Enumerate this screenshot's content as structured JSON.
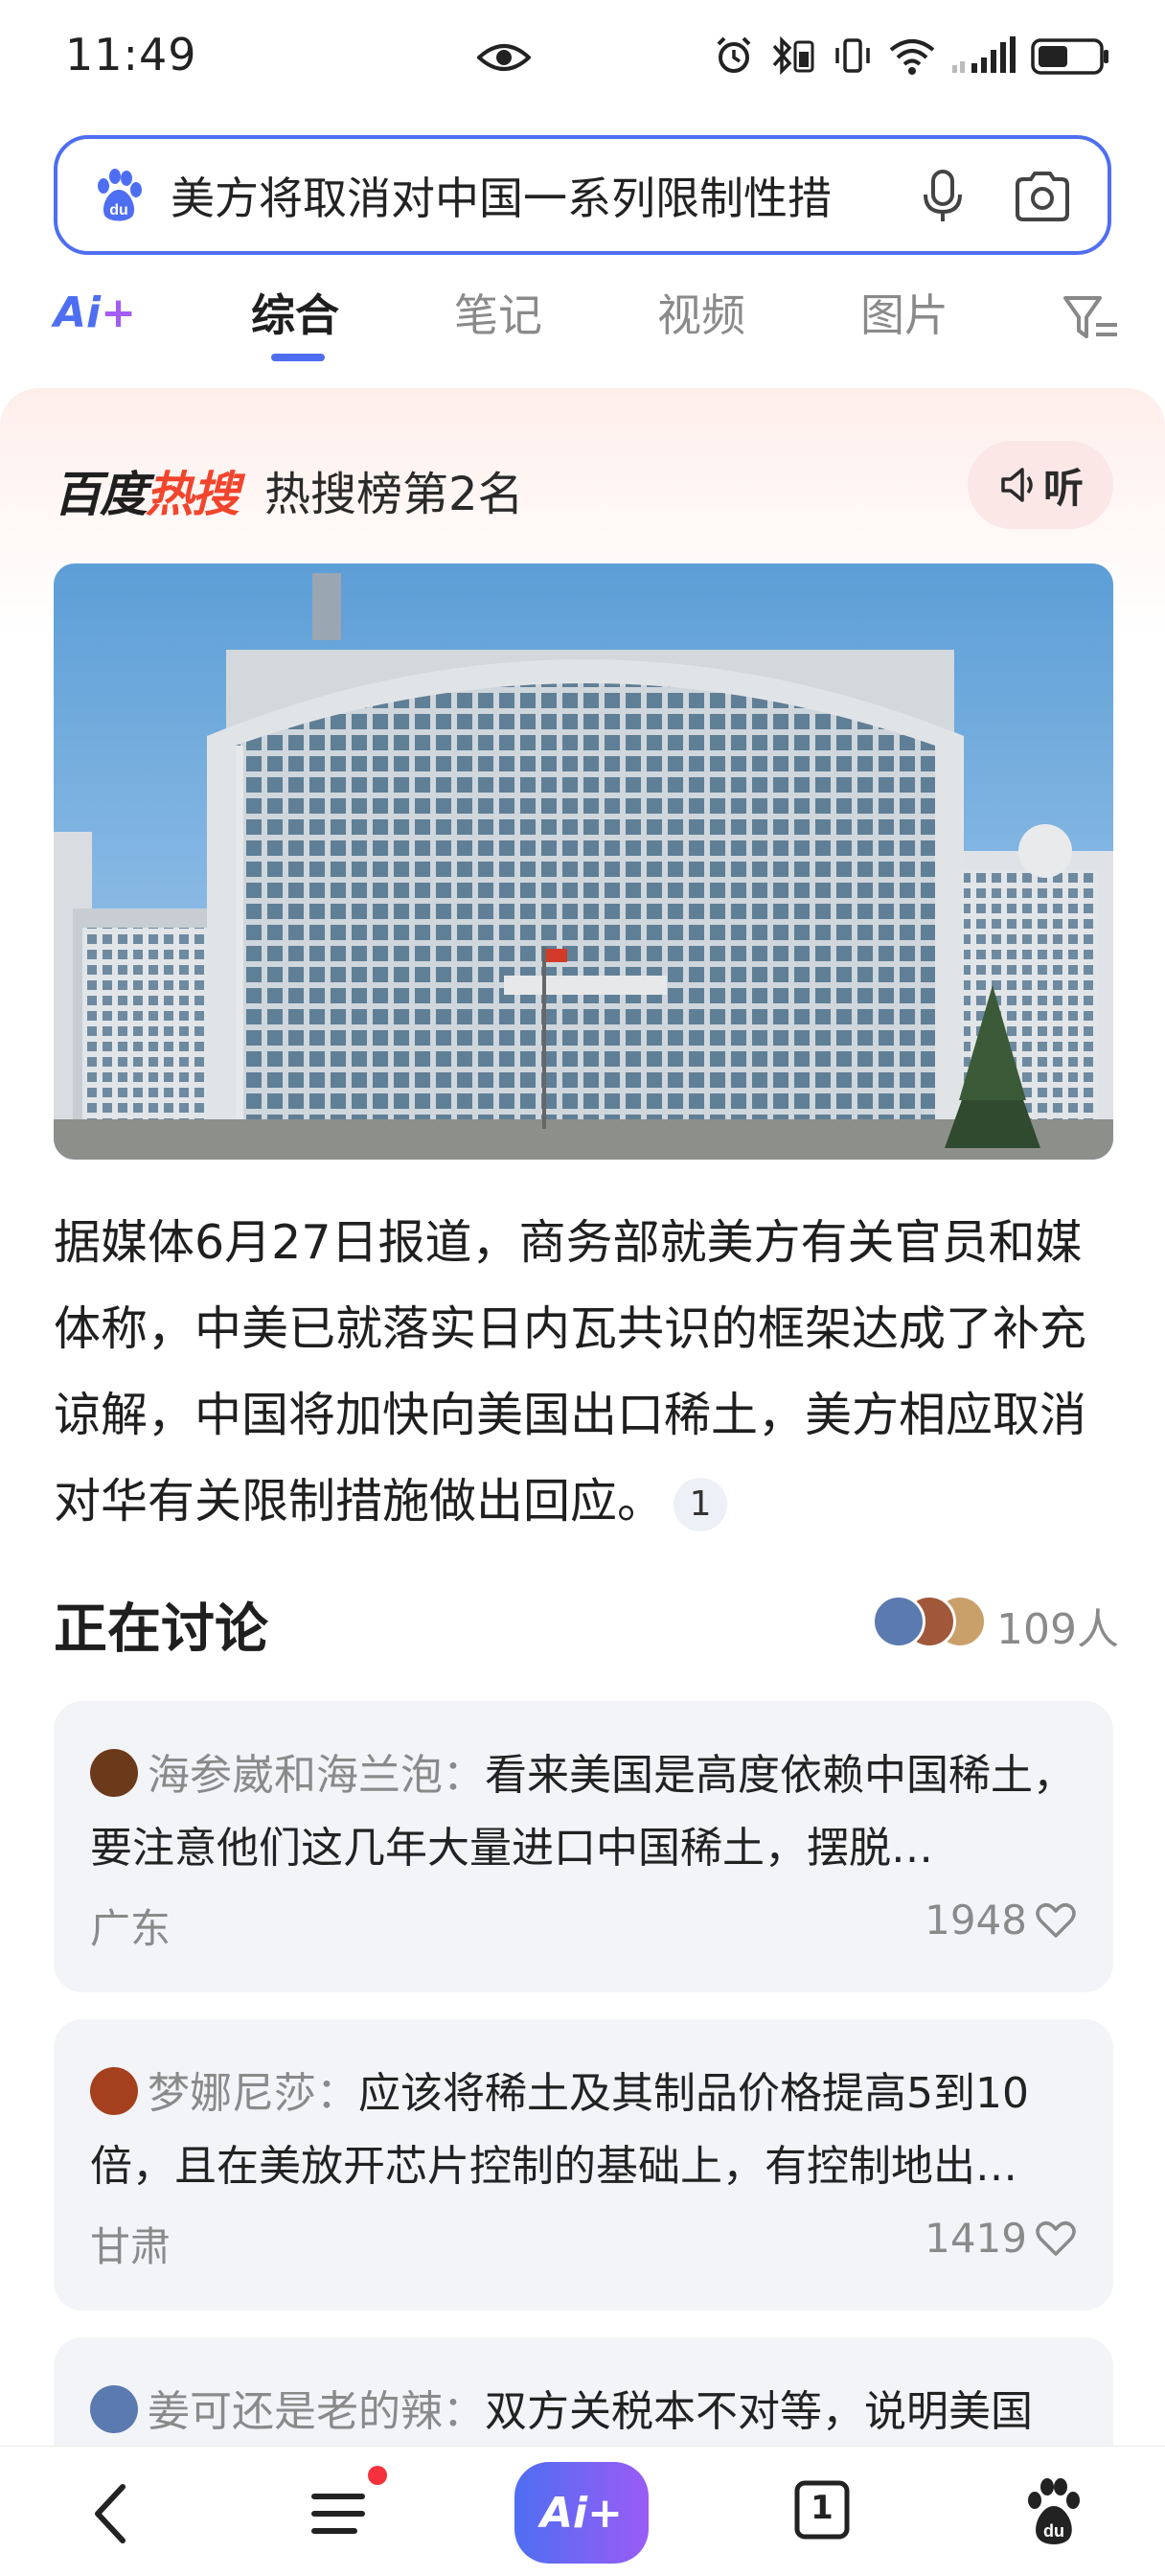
{
  "status_bar": {
    "time": "11:49"
  },
  "search": {
    "query": "美方将取消对中国一系列限制性措"
  },
  "tabs": {
    "ai_label": "Ai",
    "ai_plus": "+",
    "items": [
      {
        "label": "综合",
        "active": true
      },
      {
        "label": "笔记",
        "active": false
      },
      {
        "label": "视频",
        "active": false
      },
      {
        "label": "图片",
        "active": false
      }
    ]
  },
  "hot_search": {
    "brand_black": "百度",
    "brand_red": "热搜",
    "rank_text": "热搜榜第2名",
    "listen_label": "听"
  },
  "photo": {
    "description_icon": "building-photo"
  },
  "summary": {
    "text": "据媒体6月27日报道，商务部就美方有关官员和媒体称，中美已就落实日内瓦共识的框架达成了补充谅解，中国将加快向美国出口稀土，美方相应取消对华有关限制措施做出回应。",
    "citation": "1"
  },
  "discussion": {
    "title": "正在讨论",
    "count": "109人",
    "comments": [
      {
        "user": "海参崴和海兰泡：",
        "text": "看来美国是高度依赖中国稀土，要注意他们这几年大量进口中国稀土，摆脱…",
        "location": "广东",
        "likes": "1948"
      },
      {
        "user": "梦娜尼莎：",
        "text": "应该将稀土及其制品价格提高5到10倍，且在美放开芯片控制的基础上，有控制地出…",
        "location": "甘肃",
        "likes": "1419"
      },
      {
        "user": "姜可还是老的辣：",
        "text": "双方关税本不对等，说明美国",
        "location": "",
        "likes": ""
      }
    ]
  },
  "bottom_nav": {
    "ai_label": "Ai+",
    "tab_count": "1"
  },
  "colors": {
    "accent": "#4e6ef2",
    "hot_red": "#f2452d",
    "card_bg": "#f3f4f8"
  }
}
